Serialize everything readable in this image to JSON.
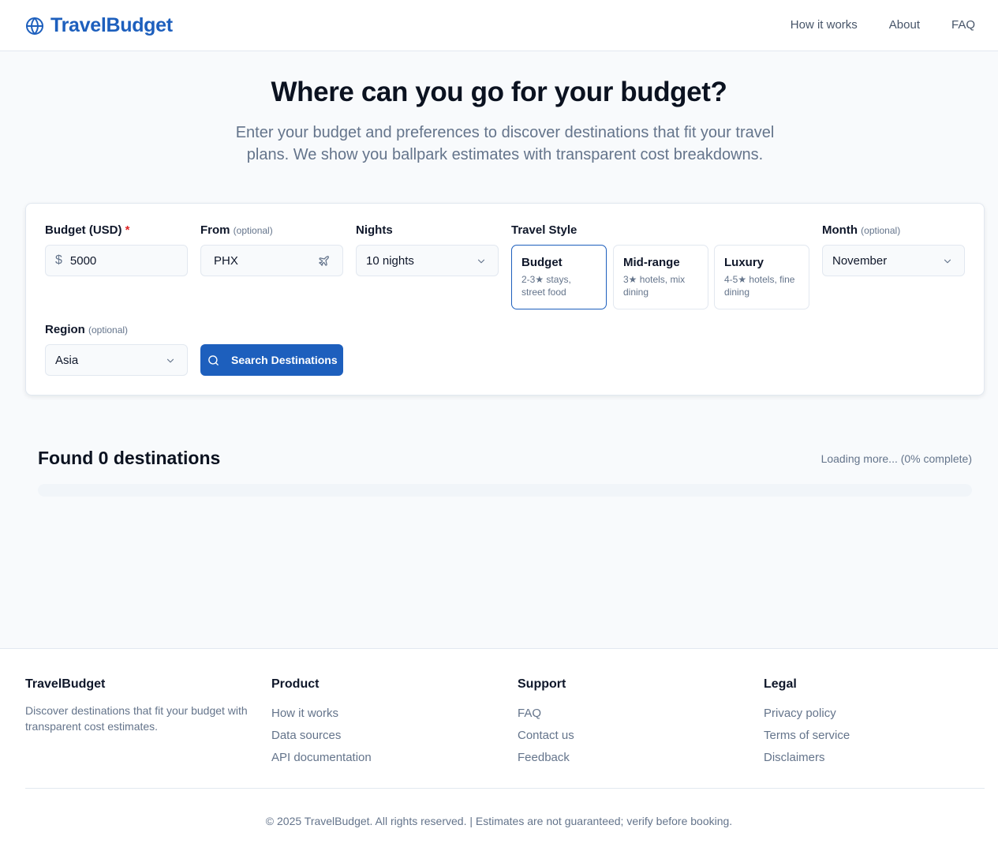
{
  "header": {
    "brand": "TravelBudget",
    "nav": [
      {
        "label": "How it works"
      },
      {
        "label": "About"
      },
      {
        "label": "FAQ"
      }
    ]
  },
  "hero": {
    "title": "Where can you go for your budget?",
    "subtitle": "Enter your budget and preferences to discover destinations that fit your travel plans. We show you ballpark estimates with transparent cost breakdowns."
  },
  "form": {
    "budget": {
      "label": "Budget (USD)",
      "required_mark": "*",
      "currency_symbol": "$",
      "value": "5000"
    },
    "from": {
      "label": "From",
      "optional": "(optional)",
      "value": "PHX"
    },
    "nights": {
      "label": "Nights",
      "value": "10 nights"
    },
    "travel_style": {
      "label": "Travel Style",
      "options": [
        {
          "title": "Budget",
          "desc": "2-3★ stays, street food",
          "selected": true
        },
        {
          "title": "Mid-range",
          "desc": "3★ hotels, mix dining",
          "selected": false
        },
        {
          "title": "Luxury",
          "desc": "4-5★ hotels, fine dining",
          "selected": false
        }
      ]
    },
    "month": {
      "label": "Month",
      "optional": "(optional)",
      "value": "November"
    },
    "region": {
      "label": "Region",
      "optional": "(optional)",
      "value": "Asia"
    },
    "search_button": "Search Destinations"
  },
  "results": {
    "title": "Found 0 destinations",
    "status": "Loading more... (0% complete)",
    "progress_percent": 0
  },
  "footer": {
    "brand": {
      "title": "TravelBudget",
      "desc": "Discover destinations that fit your budget with transparent cost estimates."
    },
    "product": {
      "title": "Product",
      "links": [
        "How it works",
        "Data sources",
        "API documentation"
      ]
    },
    "support": {
      "title": "Support",
      "links": [
        "FAQ",
        "Contact us",
        "Feedback"
      ]
    },
    "legal": {
      "title": "Legal",
      "links": [
        "Privacy policy",
        "Terms of service",
        "Disclaimers"
      ]
    },
    "copyright": "© 2025 TravelBudget. All rights reserved. | Estimates are not guaranteed; verify before booking."
  },
  "colors": {
    "brand": "#1d5fbd",
    "required": "#dc2626",
    "muted": "#64748b"
  }
}
